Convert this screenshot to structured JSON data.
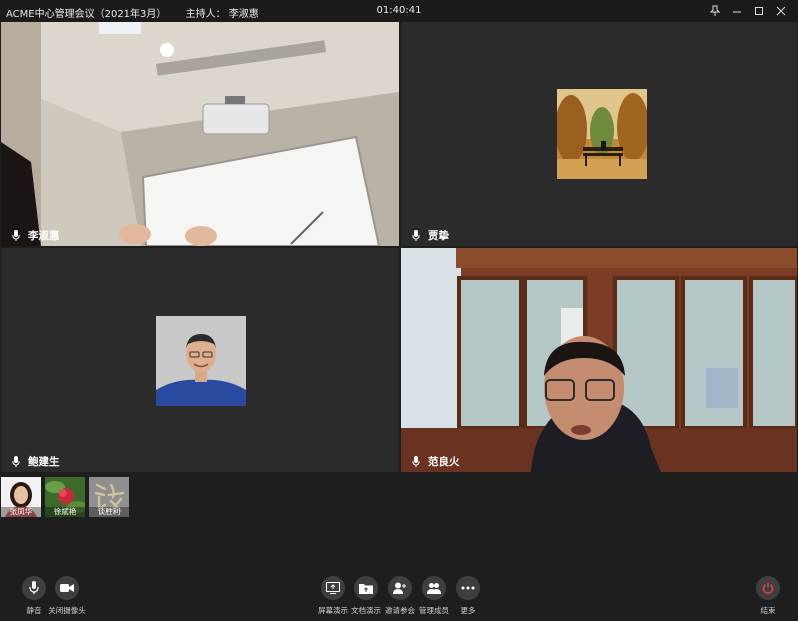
{
  "titlebar": {
    "meeting_title": "ACME中心管理会议（2021年3月）",
    "host_label": "主持人：",
    "host_name": "李淑惠",
    "timer": "01:40:41"
  },
  "window_controls": [
    "pin-icon",
    "minimize-icon",
    "maximize-icon",
    "close-icon"
  ],
  "participants": [
    {
      "name": "李淑惠",
      "video": "camera-room"
    },
    {
      "name": "贾挚",
      "video": "avatar-park"
    },
    {
      "name": "鲍建生",
      "video": "avatar-photo"
    },
    {
      "name": "范良火",
      "video": "camera-office"
    }
  ],
  "thumbnails": [
    {
      "name": "张凤华",
      "icon": "woman-portrait"
    },
    {
      "name": "徐斌艳",
      "icon": "red-flower"
    },
    {
      "name": "谈胜利",
      "icon": "calligraphy-tan"
    }
  ],
  "toolbar": {
    "mute": "静音",
    "camera_off": "关闭摄像头",
    "screen_share": "屏幕演示",
    "doc_share": "文档演示",
    "invite": "邀请参会",
    "manage": "管理成员",
    "more": "更多",
    "end": "结束"
  },
  "colors": {
    "end_red": "#e0443c",
    "bg": "#1e1e1e",
    "tile": "#2b2b2b"
  }
}
